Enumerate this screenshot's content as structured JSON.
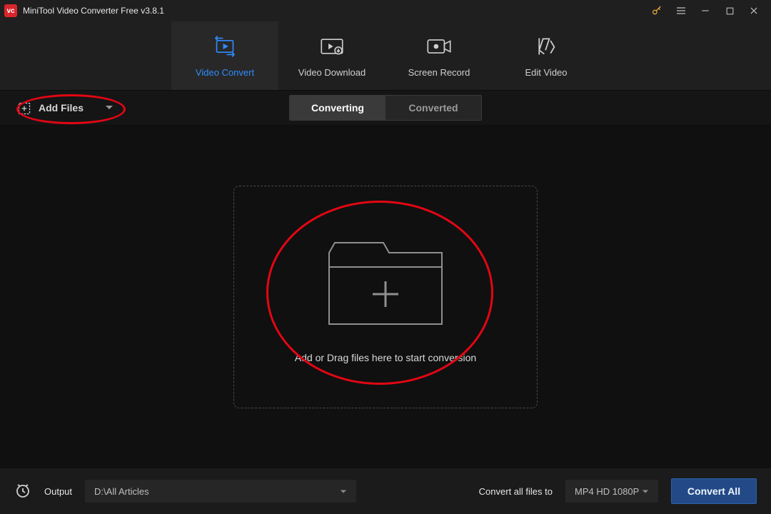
{
  "title": "MiniTool Video Converter Free v3.8.1",
  "nav": {
    "items": [
      {
        "label": "Video Convert"
      },
      {
        "label": "Video Download"
      },
      {
        "label": "Screen Record"
      },
      {
        "label": "Edit Video"
      }
    ]
  },
  "toolbar": {
    "add_files_label": "Add Files",
    "tabs": {
      "converting": "Converting",
      "converted": "Converted"
    }
  },
  "dropzone": {
    "message": "Add or Drag files here to start conversion"
  },
  "footer": {
    "output_label": "Output",
    "output_path": "D:\\All Articles",
    "convert_all_label": "Convert all files to",
    "format_selected": "MP4 HD 1080P",
    "convert_all_button": "Convert All"
  }
}
